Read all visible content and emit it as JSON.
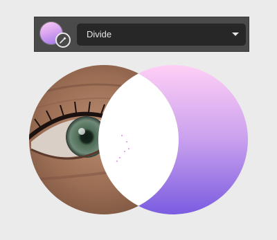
{
  "toolbar": {
    "blend_mode": "Divide",
    "swatch_icon": "color-swatch-icon",
    "picker_icon": "eyedropper-icon",
    "dropdown_icon": "chevron-down-icon"
  },
  "preview": {
    "left_layer": "eye-photo",
    "right_layer": "gradient",
    "gradient_colors": [
      "#ffcff6",
      "#c9a0ee",
      "#7a5ce0"
    ],
    "intersection_color": "#ffffff"
  }
}
